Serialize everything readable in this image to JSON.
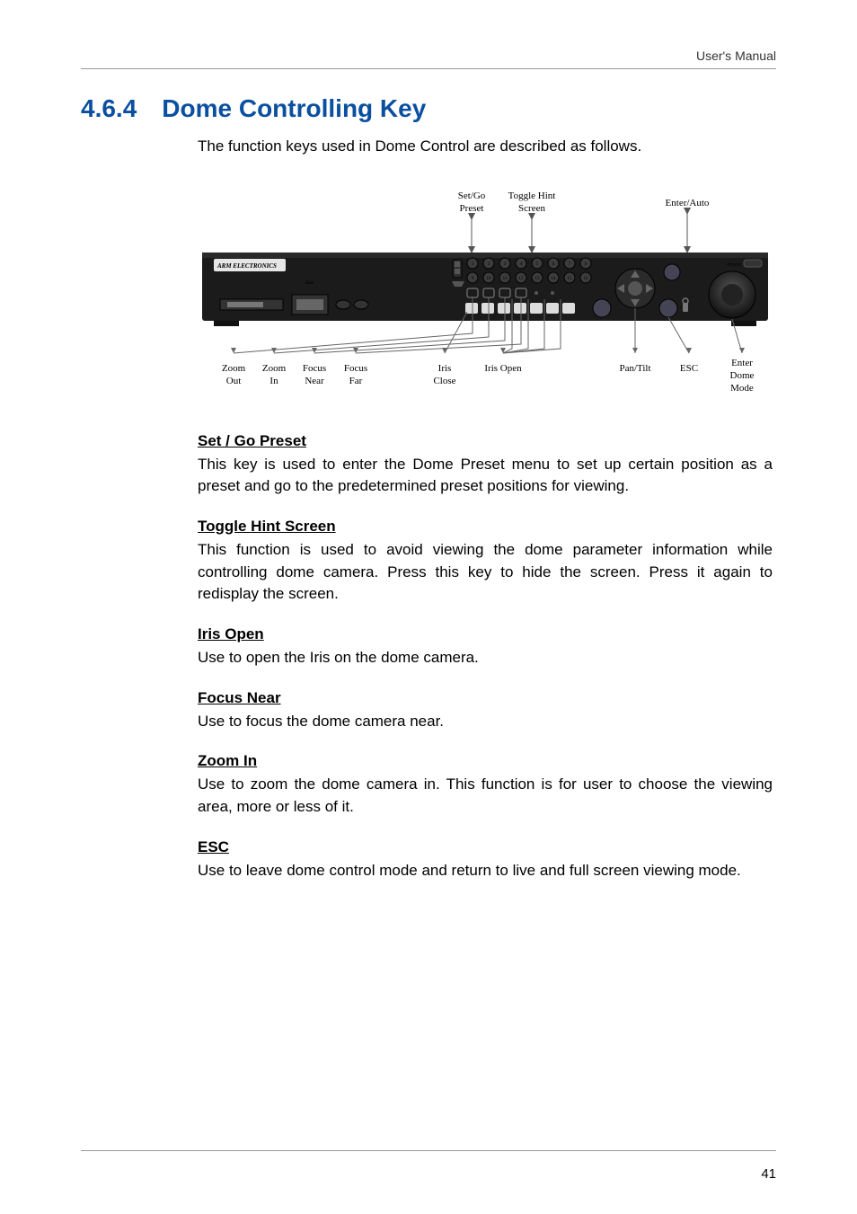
{
  "running_head": "User's Manual",
  "section": {
    "num": "4.6.4",
    "title": "Dome Controlling Key"
  },
  "intro": "The function keys used in Dome Control are described as follows.",
  "subs": {
    "set_go": {
      "h": "Set / Go Preset",
      "b": "This key is used to enter the Dome Preset menu to set up certain position as a preset and go to the predetermined preset positions for viewing."
    },
    "toggle": {
      "h": "Toggle Hint Screen",
      "b": "This function is used to avoid viewing the dome parameter information while controlling dome camera. Press this key to hide the screen. Press it again to redisplay the screen."
    },
    "iris": {
      "h": "Iris Open",
      "b": "Use to open the Iris on the dome camera."
    },
    "focus": {
      "h": "Focus Near",
      "b": "Use to focus the dome camera near."
    },
    "zoom": {
      "h": "Zoom In",
      "b": "Use to zoom the dome camera in. This function is for user to choose the viewing area, more or less of it."
    },
    "esc": {
      "h": "ESC",
      "b": "Use to leave dome control mode and return to live and full screen viewing mode."
    }
  },
  "figure": {
    "top_labels": {
      "set_go": {
        "l1": "Set/Go",
        "l2": "Preset"
      },
      "toggle": {
        "l1": "Toggle Hint",
        "l2": "Screen"
      },
      "enter_auto": "Enter/Auto"
    },
    "bottom_labels": {
      "zoom_out": {
        "l1": "Zoom",
        "l2": "Out"
      },
      "zoom_in": {
        "l1": "Zoom",
        "l2": "In"
      },
      "focus_near": {
        "l1": "Focus",
        "l2": "Near"
      },
      "focus_far": {
        "l1": "Focus",
        "l2": "Far"
      },
      "iris_close": {
        "l1": "Iris",
        "l2": "Close"
      },
      "iris_open": "Iris Open",
      "pan_tilt": "Pan/Tilt",
      "esc_l": "ESC",
      "enter_dome": {
        "l1": "Enter",
        "l2": "Dome",
        "l3": "Mode"
      }
    },
    "device": {
      "brand": "ARM ELECTRONICS",
      "disc_label": "disc",
      "power_label": "Power"
    }
  },
  "page_number": "41"
}
